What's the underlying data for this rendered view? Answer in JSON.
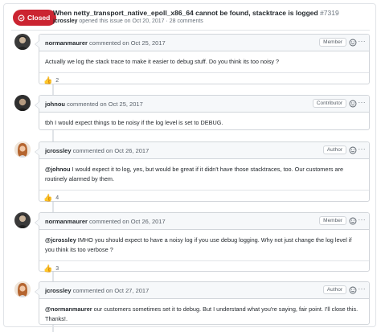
{
  "issue": {
    "status": "Closed",
    "title": "When netty_transport_native_epoll_x86_64 cannot be found, stacktrace is logged",
    "number": "#7319",
    "opener": "jcrossley",
    "meta_rest": "opened this issue on Oct 20, 2017 · 28 comments",
    "status_color": "#cb2431"
  },
  "comments": [
    {
      "author": "normanmaurer",
      "when": "commented on Oct 25, 2017",
      "role": "Member",
      "body": "Actually we log the stack trace to make it easier to debug stuff. Do you think its too noisy ?",
      "reaction_count": "2"
    },
    {
      "author": "johnou",
      "when": "commented on Oct 25, 2017",
      "role": "Contributor",
      "body": "tbh I would expect things to be noisy if the log level is set to DEBUG."
    },
    {
      "author": "jcrossley",
      "when": "commented on Oct 26, 2017",
      "role": "Author",
      "mention": "@johnou",
      "body": " I would expect it to log, yes, but would be great if it didn't have those stacktraces, too. Our customers are routinely alarmed by them.",
      "reaction_count": "4"
    },
    {
      "author": "normanmaurer",
      "when": "commented on Oct 26, 2017",
      "role": "Member",
      "mention": "@jcrossley",
      "body": " IMHO you should expect to have a noisy log if you use debug logging. Why not just change the log level if you think its too verbose ?",
      "reaction_count": "3"
    },
    {
      "author": "jcrossley",
      "when": "commented on Oct 27, 2017",
      "role": "Author",
      "mention": "@normanmaurer",
      "body": " our customers sometimes set it to debug. But I understand what you're saying, fair point. I'll close this. Thanks!."
    }
  ],
  "icons": {
    "reaction": "thumbs-up-icon",
    "emoji": "smiley-icon",
    "more": "kebab-icon"
  }
}
